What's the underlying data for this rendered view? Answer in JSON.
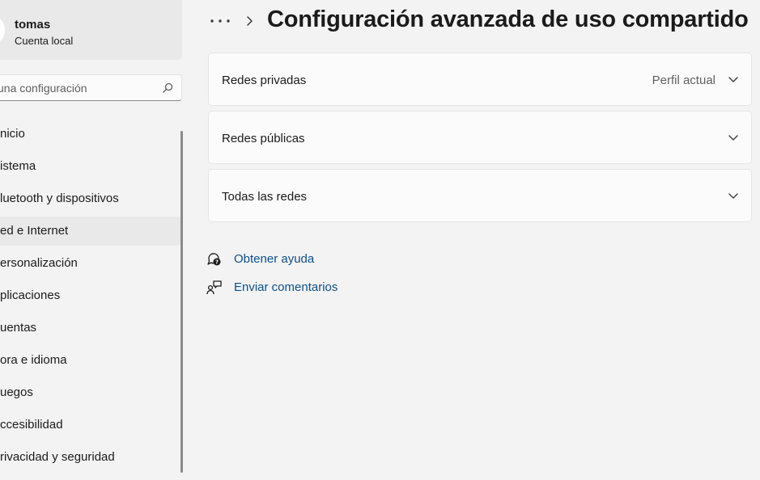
{
  "user": {
    "name": "tomas",
    "account_type": "Cuenta local"
  },
  "search": {
    "placeholder": "una configuración",
    "icon": "search-icon"
  },
  "sidebar": {
    "items": [
      {
        "label": "nicio",
        "selected": false
      },
      {
        "label": "istema",
        "selected": false
      },
      {
        "label": "luetooth y dispositivos",
        "selected": false
      },
      {
        "label": "ed e Internet",
        "selected": true
      },
      {
        "label": "ersonalización",
        "selected": false
      },
      {
        "label": "plicaciones",
        "selected": false
      },
      {
        "label": "uentas",
        "selected": false
      },
      {
        "label": "ora e idioma",
        "selected": false
      },
      {
        "label": "uegos",
        "selected": false
      },
      {
        "label": "ccesibilidad",
        "selected": false
      },
      {
        "label": "rivacidad y seguridad",
        "selected": false
      }
    ]
  },
  "header": {
    "more_icon": "more-icon",
    "chevron_icon": "chevron-right-icon",
    "title": "Configuración avanzada de uso compartido"
  },
  "cards": [
    {
      "label": "Redes privadas",
      "status": "Perfil actual",
      "icon": "chevron-down-icon"
    },
    {
      "label": "Redes públicas",
      "status": "",
      "icon": "chevron-down-icon"
    },
    {
      "label": "Todas las redes",
      "status": "",
      "icon": "chevron-down-icon"
    }
  ],
  "links": {
    "help": {
      "label": "Obtener ayuda",
      "icon": "help-icon"
    },
    "feedback": {
      "label": "Enviar comentarios",
      "icon": "feedback-icon"
    }
  },
  "colors": {
    "background": "#f3f3f3",
    "card": "#fbfbfb",
    "selected": "#e9e9e9",
    "link": "#0e4f86",
    "text": "#1b1b1b"
  }
}
